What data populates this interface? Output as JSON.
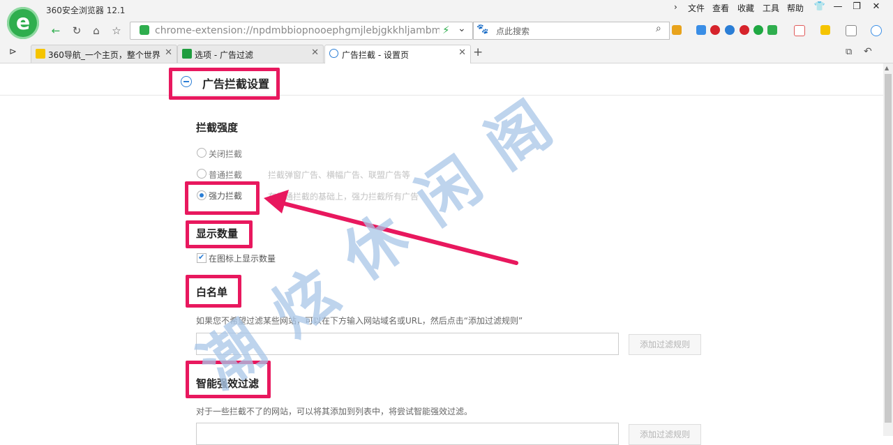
{
  "browser": {
    "app_title": "360安全浏览器 12.1",
    "menu": [
      "文件",
      "查看",
      "收藏",
      "工具",
      "帮助"
    ],
    "url": "chrome-extension://npdmbbiopnooephgmjlebjgkkhljambm/opt",
    "search_placeholder": "点此搜索",
    "tabs": [
      {
        "label": "360导航_一个主页，整个世界",
        "active": false,
        "favicon_color": "#f5c400"
      },
      {
        "label": "选项 - 广告过滤",
        "active": false,
        "favicon_color": "#1f9d3f"
      },
      {
        "label": "广告拦截 - 设置页",
        "active": true,
        "favicon_color": "#2b7ed6"
      }
    ],
    "new_tab_label": "+"
  },
  "page": {
    "title": "广告拦截设置",
    "block_strength": {
      "heading": "拦截强度",
      "options": [
        {
          "label": "关闭拦截",
          "desc": "",
          "checked": false
        },
        {
          "label": "普通拦截",
          "desc": "拦截弹窗广告、横幅广告、联盟广告等",
          "checked": false
        },
        {
          "label": "强力拦截",
          "desc": "在普通拦截的基础上，强力拦截所有广告",
          "checked": true
        }
      ]
    },
    "show_count": {
      "heading": "显示数量",
      "checkbox_label": "在图标上显示数量",
      "checked": true
    },
    "whitelist": {
      "heading": "白名单",
      "desc": "如果您不希望过滤某些网站，可以在下方输入网站域名或URL，然后点击“添加过滤规则”",
      "input_value": "",
      "button_label": "添加过滤规则"
    },
    "smart_filter": {
      "heading": "智能强效过滤",
      "desc": "对于一些拦截不了的网站，可以将其添加到列表中，将尝试智能强效过滤。",
      "input_value": "",
      "button_label": "添加过滤规则"
    }
  },
  "annotation": {
    "watermark": "潮炫休闲阁",
    "highlight_color": "#e8185e"
  }
}
